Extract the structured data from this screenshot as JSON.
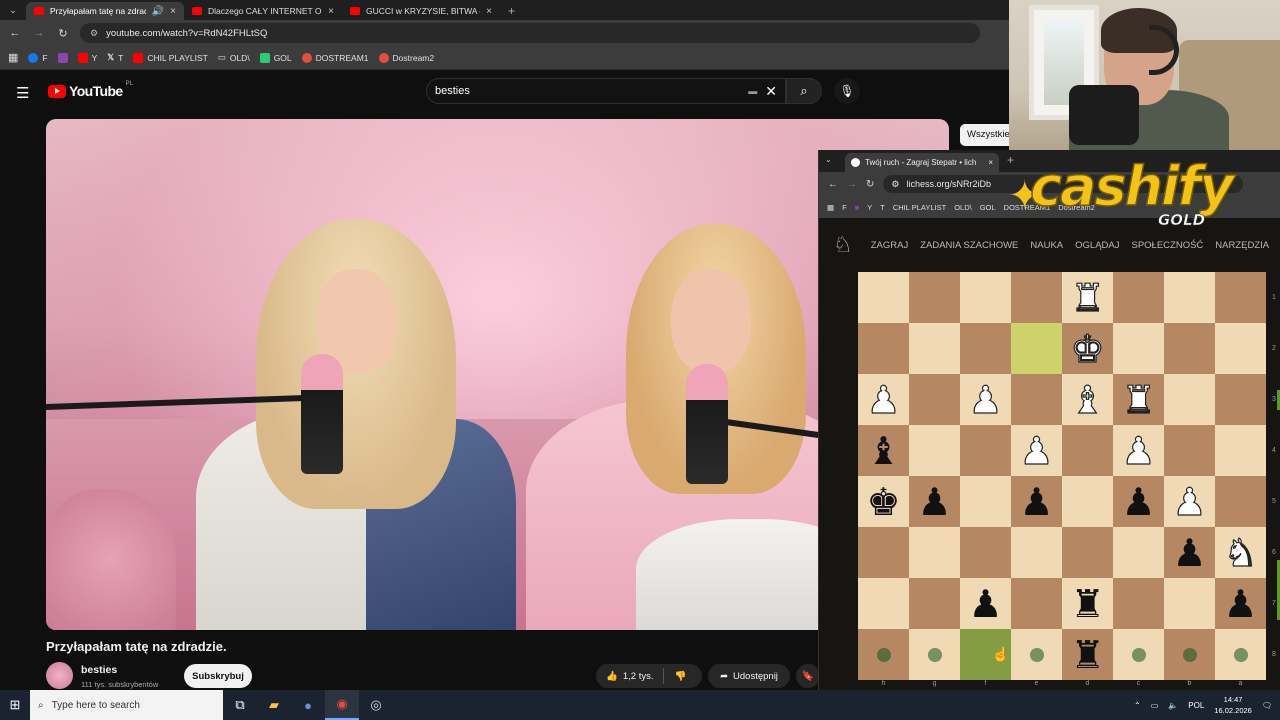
{
  "browser": {
    "tabs": [
      {
        "title": "Przyłapałam tatę na zdradzie",
        "active": true
      },
      {
        "title": "Dlaczego CAŁY INTERNET Obs",
        "active": false
      },
      {
        "title": "GUCCI w KRYZYSIE, BITWA o TA",
        "active": false
      }
    ],
    "url": "youtube.com/watch?v=RdN42FHLtSQ",
    "bookmarks": [
      {
        "label": "F",
        "color": "#1877f2"
      },
      {
        "label": "",
        "color": "#8e44ad"
      },
      {
        "label": "Y",
        "color": "#ff0000"
      },
      {
        "label": "T",
        "color": "#ffffff"
      },
      {
        "label": "CHIL PLAYLIST",
        "color": "#ff0000"
      },
      {
        "label": "OLD\\",
        "color": "#cccccc"
      },
      {
        "label": "GOL",
        "color": "#2ecc71"
      },
      {
        "label": "DOSTREAM1",
        "color": "#e74c3c"
      },
      {
        "label": "Dostream2",
        "color": "#e74c3c"
      }
    ]
  },
  "youtube": {
    "logo_text": "YouTube",
    "country": "PL",
    "search_value": "besties",
    "chip_label": "Wszystkie",
    "video_title": "Przyłapałam tatę na zdradzie.",
    "channel_name": "besties",
    "channel_subs": "111 tys. subskrybentów",
    "subscribe_label": "Subskrybuj",
    "likes": "1,2 tys.",
    "share_label": "Udostępnij"
  },
  "lichess": {
    "tab_title": "Twój ruch - Zagraj Stepatr • lich",
    "url": "lichess.org/sNRr2iDb",
    "bookmarks": [
      "F",
      "",
      "Y",
      "T",
      "CHIL PLAYLIST",
      "OLD\\",
      "GOL",
      "DOSTREAM1",
      "Dostream2"
    ],
    "nav": [
      "ZAGRAJ",
      "ZADANIA SZACHOWE",
      "NAUKA",
      "OGLĄDAJ",
      "SPOŁECZNOŚĆ",
      "NARZĘDZIA"
    ],
    "ranks": [
      "1",
      "2",
      "3",
      "4",
      "5",
      "6",
      "7",
      "8"
    ],
    "files": [
      "h",
      "g",
      "f",
      "e",
      "d",
      "c",
      "b",
      "a"
    ],
    "board": [
      [
        "",
        "",
        "",
        "",
        "wR",
        "",
        "",
        ""
      ],
      [
        "",
        "",
        "",
        "hl",
        "wK",
        "",
        "",
        ""
      ],
      [
        "wP",
        "",
        "wP",
        "",
        "wB",
        "wR",
        "",
        ""
      ],
      [
        "bB",
        "",
        "",
        "wP",
        "",
        "wP",
        "",
        ""
      ],
      [
        "bK",
        "bP",
        "",
        "bP",
        "",
        "bP",
        "wP",
        ""
      ],
      [
        "",
        "",
        "",
        "",
        "",
        "",
        "bP",
        "wN"
      ],
      [
        "",
        "",
        "bP",
        "",
        "bR",
        "",
        "",
        "bP"
      ],
      [
        "dot",
        "dot",
        "sel",
        "dot",
        "bR",
        "dot",
        "dot",
        "dot"
      ]
    ]
  },
  "overlay": {
    "brand": "cashify",
    "tier": "GOLD"
  },
  "taskbar": {
    "search_placeholder": "Type here to search",
    "lang": "POL",
    "time": "14:47",
    "date": "16.02.2026"
  }
}
